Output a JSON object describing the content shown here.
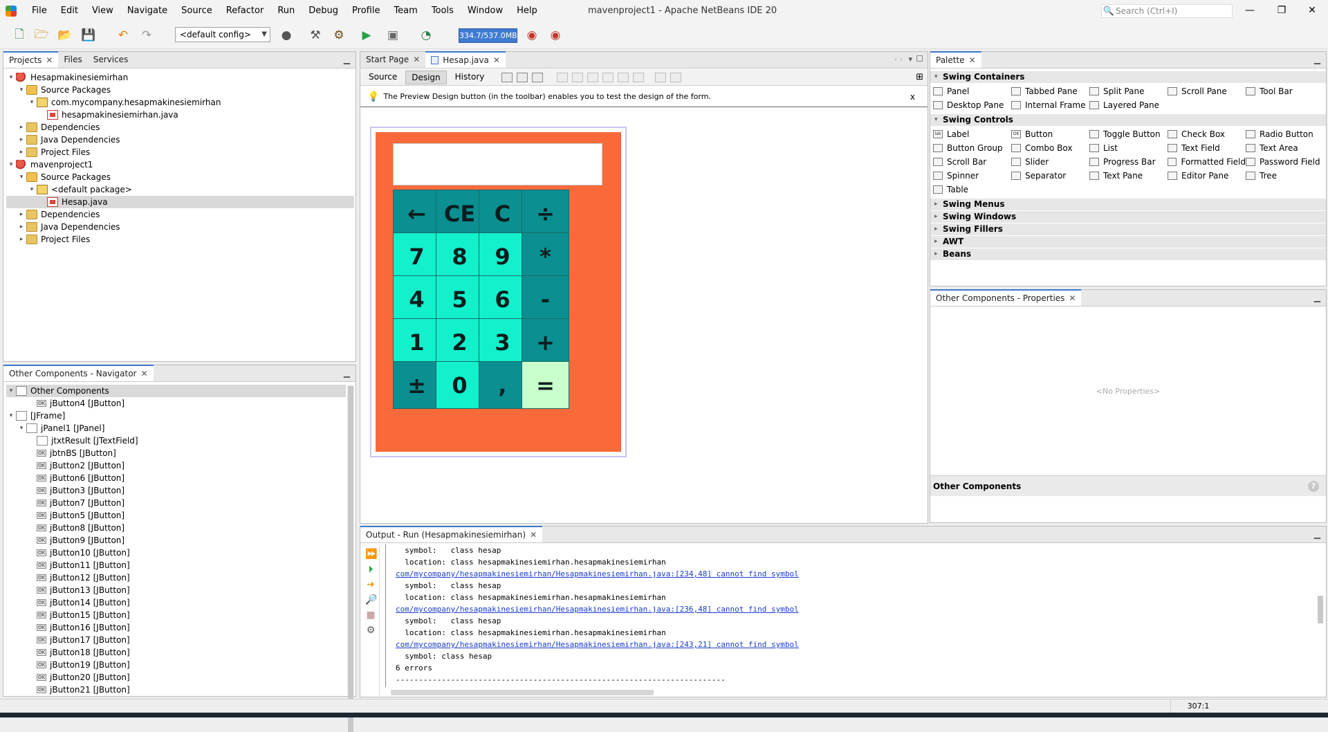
{
  "menubar": {
    "items": [
      "File",
      "Edit",
      "View",
      "Navigate",
      "Source",
      "Refactor",
      "Run",
      "Debug",
      "Profile",
      "Team",
      "Tools",
      "Window",
      "Help"
    ],
    "window_title": "mavenproject1 - Apache NetBeans IDE 20",
    "search_placeholder": "Search (Ctrl+I)"
  },
  "toolbar": {
    "config": "<default config>",
    "memory": "334.7/537.0MB"
  },
  "projects": {
    "tabs": [
      "Projects",
      "Files",
      "Services"
    ],
    "tree": [
      {
        "label": "Hesapmakinesiemirhan",
        "indent": 0,
        "toggle": "▾",
        "icon": "proj"
      },
      {
        "label": "Source Packages",
        "indent": 1,
        "toggle": "▾",
        "icon": "pkgfolder"
      },
      {
        "label": "com.mycompany.hesapmakinesiemirhan",
        "indent": 2,
        "toggle": "▾",
        "icon": "pkg"
      },
      {
        "label": "hesapmakinesiemirhan.java",
        "indent": 3,
        "toggle": "",
        "icon": "java"
      },
      {
        "label": "Dependencies",
        "indent": 1,
        "toggle": "▸",
        "icon": "folder"
      },
      {
        "label": "Java Dependencies",
        "indent": 1,
        "toggle": "▸",
        "icon": "folder"
      },
      {
        "label": "Project Files",
        "indent": 1,
        "toggle": "▸",
        "icon": "folder"
      },
      {
        "label": "mavenproject1",
        "indent": 0,
        "toggle": "▾",
        "icon": "proj"
      },
      {
        "label": "Source Packages",
        "indent": 1,
        "toggle": "▾",
        "icon": "pkgfolder"
      },
      {
        "label": "<default package>",
        "indent": 2,
        "toggle": "▾",
        "icon": "pkg"
      },
      {
        "label": "Hesap.java",
        "indent": 3,
        "toggle": "",
        "icon": "java",
        "selected": true
      },
      {
        "label": "Dependencies",
        "indent": 1,
        "toggle": "▸",
        "icon": "folder"
      },
      {
        "label": "Java Dependencies",
        "indent": 1,
        "toggle": "▸",
        "icon": "folder"
      },
      {
        "label": "Project Files",
        "indent": 1,
        "toggle": "▸",
        "icon": "folder"
      }
    ]
  },
  "navigator": {
    "tab": "Other Components - Navigator",
    "tree": [
      {
        "label": "Other Components",
        "indent": 0,
        "toggle": "▾",
        "icon": "comp",
        "selected": true
      },
      {
        "label": "jButton4 [JButton]",
        "indent": 2,
        "toggle": "",
        "icon": "btn"
      },
      {
        "label": "[JFrame]",
        "indent": 0,
        "toggle": "▾",
        "icon": "comp"
      },
      {
        "label": "jPanel1 [JPanel]",
        "indent": 1,
        "toggle": "▾",
        "icon": "comp"
      },
      {
        "label": "jtxtResult [JTextField]",
        "indent": 2,
        "toggle": "",
        "icon": "comp"
      },
      {
        "label": "jbtnBS [JButton]",
        "indent": 2,
        "toggle": "",
        "icon": "btn"
      },
      {
        "label": "jButton2 [JButton]",
        "indent": 2,
        "toggle": "",
        "icon": "btn"
      },
      {
        "label": "jButton6 [JButton]",
        "indent": 2,
        "toggle": "",
        "icon": "btn"
      },
      {
        "label": "jButton3 [JButton]",
        "indent": 2,
        "toggle": "",
        "icon": "btn"
      },
      {
        "label": "jButton7 [JButton]",
        "indent": 2,
        "toggle": "",
        "icon": "btn"
      },
      {
        "label": "jButton5 [JButton]",
        "indent": 2,
        "toggle": "",
        "icon": "btn"
      },
      {
        "label": "jButton8 [JButton]",
        "indent": 2,
        "toggle": "",
        "icon": "btn"
      },
      {
        "label": "jButton9 [JButton]",
        "indent": 2,
        "toggle": "",
        "icon": "btn"
      },
      {
        "label": "jButton10 [JButton]",
        "indent": 2,
        "toggle": "",
        "icon": "btn"
      },
      {
        "label": "jButton11 [JButton]",
        "indent": 2,
        "toggle": "",
        "icon": "btn"
      },
      {
        "label": "jButton12 [JButton]",
        "indent": 2,
        "toggle": "",
        "icon": "btn"
      },
      {
        "label": "jButton13 [JButton]",
        "indent": 2,
        "toggle": "",
        "icon": "btn"
      },
      {
        "label": "jButton14 [JButton]",
        "indent": 2,
        "toggle": "",
        "icon": "btn"
      },
      {
        "label": "jButton15 [JButton]",
        "indent": 2,
        "toggle": "",
        "icon": "btn"
      },
      {
        "label": "jButton16 [JButton]",
        "indent": 2,
        "toggle": "",
        "icon": "btn"
      },
      {
        "label": "jButton17 [JButton]",
        "indent": 2,
        "toggle": "",
        "icon": "btn"
      },
      {
        "label": "jButton18 [JButton]",
        "indent": 2,
        "toggle": "",
        "icon": "btn"
      },
      {
        "label": "jButton19 [JButton]",
        "indent": 2,
        "toggle": "",
        "icon": "btn"
      },
      {
        "label": "jButton20 [JButton]",
        "indent": 2,
        "toggle": "",
        "icon": "btn"
      },
      {
        "label": "jButton21 [JButton]",
        "indent": 2,
        "toggle": "",
        "icon": "btn"
      }
    ]
  },
  "editor": {
    "tabs": [
      "Start Page",
      "Hesap.java"
    ],
    "views": [
      "Source",
      "Design",
      "History"
    ],
    "hint": "The Preview Design button (in the toolbar) enables you to test the design of the form.",
    "hint_close": "x"
  },
  "calculator": {
    "rows": [
      [
        {
          "t": "←",
          "c": "teal"
        },
        {
          "t": "CE",
          "c": "teal"
        },
        {
          "t": "C",
          "c": "teal"
        },
        {
          "t": "÷",
          "c": "teal"
        }
      ],
      [
        {
          "t": "7",
          "c": "aqua"
        },
        {
          "t": "8",
          "c": "aqua"
        },
        {
          "t": "9",
          "c": "aqua"
        },
        {
          "t": "*",
          "c": "teal"
        }
      ],
      [
        {
          "t": "4",
          "c": "aqua"
        },
        {
          "t": "5",
          "c": "aqua"
        },
        {
          "t": "6",
          "c": "aqua"
        },
        {
          "t": "-",
          "c": "teal"
        }
      ],
      [
        {
          "t": "1",
          "c": "aqua"
        },
        {
          "t": "2",
          "c": "aqua"
        },
        {
          "t": "3",
          "c": "aqua"
        },
        {
          "t": "+",
          "c": "teal"
        }
      ],
      [
        {
          "t": "±",
          "c": "teal"
        },
        {
          "t": "0",
          "c": "aqua"
        },
        {
          "t": ",",
          "c": "teal"
        },
        {
          "t": "=",
          "c": "eq"
        }
      ]
    ]
  },
  "palette": {
    "tab": "Palette",
    "sections": [
      {
        "name": "Swing Containers",
        "open": true,
        "items": [
          "Panel",
          "Tabbed Pane",
          "Split Pane",
          "Scroll Pane",
          "Tool Bar",
          "Desktop Pane",
          "Internal Frame",
          "Layered Pane"
        ]
      },
      {
        "name": "Swing Controls",
        "open": true,
        "items": [
          "Label",
          "Button",
          "Toggle Button",
          "Check Box",
          "Radio Button",
          "Button Group",
          "Combo Box",
          "List",
          "Text Field",
          "Text Area",
          "Scroll Bar",
          "Slider",
          "Progress Bar",
          "Formatted Field",
          "Password Field",
          "Spinner",
          "Separator",
          "Text Pane",
          "Editor Pane",
          "Tree",
          "Table"
        ]
      },
      {
        "name": "Swing Menus",
        "open": false,
        "items": []
      },
      {
        "name": "Swing Windows",
        "open": false,
        "items": []
      },
      {
        "name": "Swing Fillers",
        "open": false,
        "items": []
      },
      {
        "name": "AWT",
        "open": false,
        "items": []
      },
      {
        "name": "Beans",
        "open": false,
        "items": []
      }
    ]
  },
  "properties": {
    "tab": "Other Components - Properties",
    "empty": "<No Properties>",
    "footer": "Other Components",
    "help": "?"
  },
  "output": {
    "tab": "Output - Run (Hesapmakinesiemirhan)",
    "lines": [
      {
        "text": "  symbol:   class hesap",
        "link": false
      },
      {
        "text": "  location: class hesapmakinesiemirhan.hesapmakinesiemirhan",
        "link": false
      },
      {
        "text": "com/mycompany/hesapmakinesiemirhan/Hesapmakinesiemirhan.java:[234,48] cannot find symbol",
        "link": true
      },
      {
        "text": "  symbol:   class hesap",
        "link": false
      },
      {
        "text": "  location: class hesapmakinesiemirhan.hesapmakinesiemirhan",
        "link": false
      },
      {
        "text": "com/mycompany/hesapmakinesiemirhan/Hesapmakinesiemirhan.java:[236,48] cannot find symbol",
        "link": true
      },
      {
        "text": "  symbol:   class hesap",
        "link": false
      },
      {
        "text": "  location: class hesapmakinesiemirhan.hesapmakinesiemirhan",
        "link": false
      },
      {
        "text": "com/mycompany/hesapmakinesiemirhan/Hesapmakinesiemirhan.java:[243,21] cannot find symbol",
        "link": true
      },
      {
        "text": "  symbol: class hesap",
        "link": false
      },
      {
        "text": "6 errors",
        "link": false
      },
      {
        "text": "------------------------------------------------------------------------",
        "link": false
      }
    ]
  },
  "status": {
    "position": "307:1"
  },
  "colors": {
    "calc_bg": "#f96a3a",
    "key_aqua": "#12f0cc",
    "key_teal": "#0b8f90",
    "key_equals": "#c9ffcc",
    "memory_bar": "#3f7bd2"
  }
}
